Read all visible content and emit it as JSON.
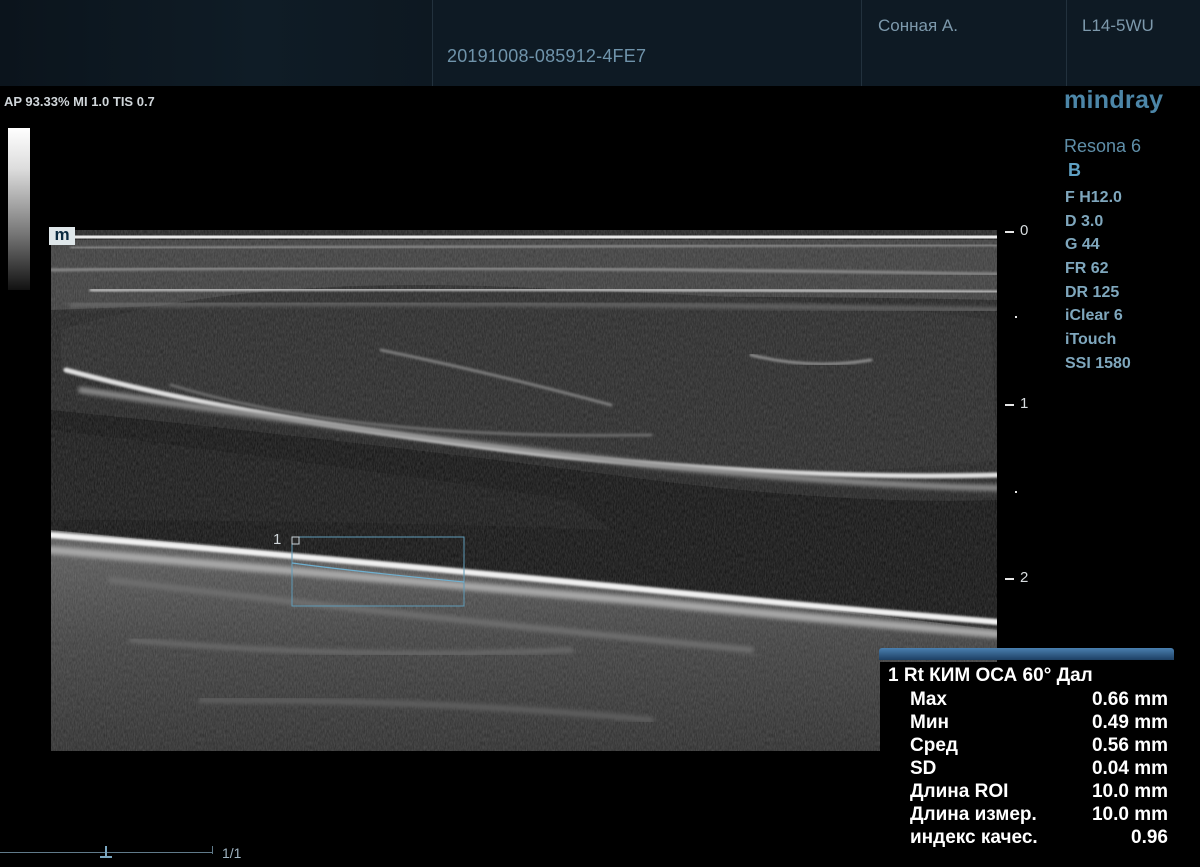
{
  "header": {
    "study_id": "20191008-085912-4FE7",
    "patient_name": "Сонная А.",
    "probe": "L14-5WU"
  },
  "acoustic_info": "AP 93.33%  MI 1.0 TIS 0.7",
  "brand": "mindray",
  "model": "Resona 6",
  "mode": "B",
  "params": [
    "F H12.0",
    "D 3.0",
    "G 44",
    "FR 62",
    "DR 125",
    "iClear 6",
    "iTouch",
    "SSI 1580"
  ],
  "image_marker": "m",
  "depth_scale": [
    "0",
    "1",
    "2"
  ],
  "roi_number": "1",
  "measurement": {
    "title": "1  Rt КИМ ОСА 60° Дал",
    "rows": [
      {
        "label": "Max",
        "value": "0.66 mm"
      },
      {
        "label": "Мин",
        "value": "0.49 mm"
      },
      {
        "label": "Сред",
        "value": "0.56 mm"
      },
      {
        "label": "SD",
        "value": "0.04 mm"
      },
      {
        "label": "Длина ROI",
        "value": "10.0 mm"
      },
      {
        "label": "Длина измер.",
        "value": "10.0 mm"
      },
      {
        "label": "индекс качес.",
        "value": "0.96"
      }
    ]
  },
  "cine": {
    "frame_counter": "1/1"
  },
  "colors": {
    "accent": "#4c86a8",
    "panel_bar": "#3b6e9e",
    "roi": "#5f9bb8"
  }
}
